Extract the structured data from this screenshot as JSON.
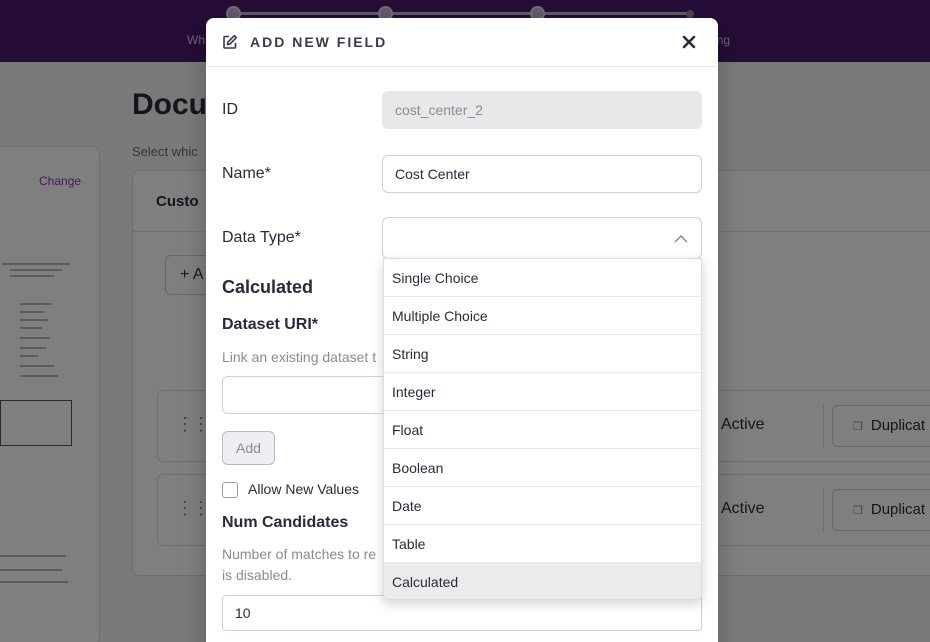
{
  "background": {
    "steps": [
      {
        "label": "Wh",
        "state": "done"
      },
      {
        "label": "",
        "state": "done"
      },
      {
        "label": "",
        "state": "current"
      },
      {
        "label": "ing",
        "state": "pending"
      }
    ],
    "page_title": "Docu",
    "page_subtitle": "Select whic",
    "change_link": "Change",
    "card_header": "Custo",
    "add_button": "+ A",
    "rows": [
      {
        "status": "Active",
        "duplicate": "Duplicat"
      },
      {
        "status": "Active",
        "duplicate": "Duplicat"
      }
    ]
  },
  "modal": {
    "title": "ADD NEW FIELD",
    "id_label": "ID",
    "id_value": "cost_center_2",
    "name_label": "Name*",
    "name_value": "Cost Center",
    "data_type_label": "Data Type*",
    "data_type_value": "",
    "section_title": "Calculated",
    "dataset_uri_label": "Dataset URI*",
    "dataset_uri_help": "Link an existing dataset t",
    "dataset_uri_value": "",
    "add_button": "Add",
    "allow_new_values_label": "Allow New Values",
    "allow_new_values_checked": false,
    "num_candidates_label": "Num Candidates",
    "num_candidates_help_line1": "Number of matches to re",
    "num_candidates_help_line2": "is disabled.",
    "num_candidates_value": "10"
  },
  "dropdown": {
    "options": [
      "Single Choice",
      "Multiple Choice",
      "String",
      "Integer",
      "Float",
      "Boolean",
      "Date",
      "Table",
      "Calculated"
    ],
    "hovered_index": 8
  },
  "colors": {
    "brand": "#4a1a6e",
    "link": "#8a3aa8"
  }
}
